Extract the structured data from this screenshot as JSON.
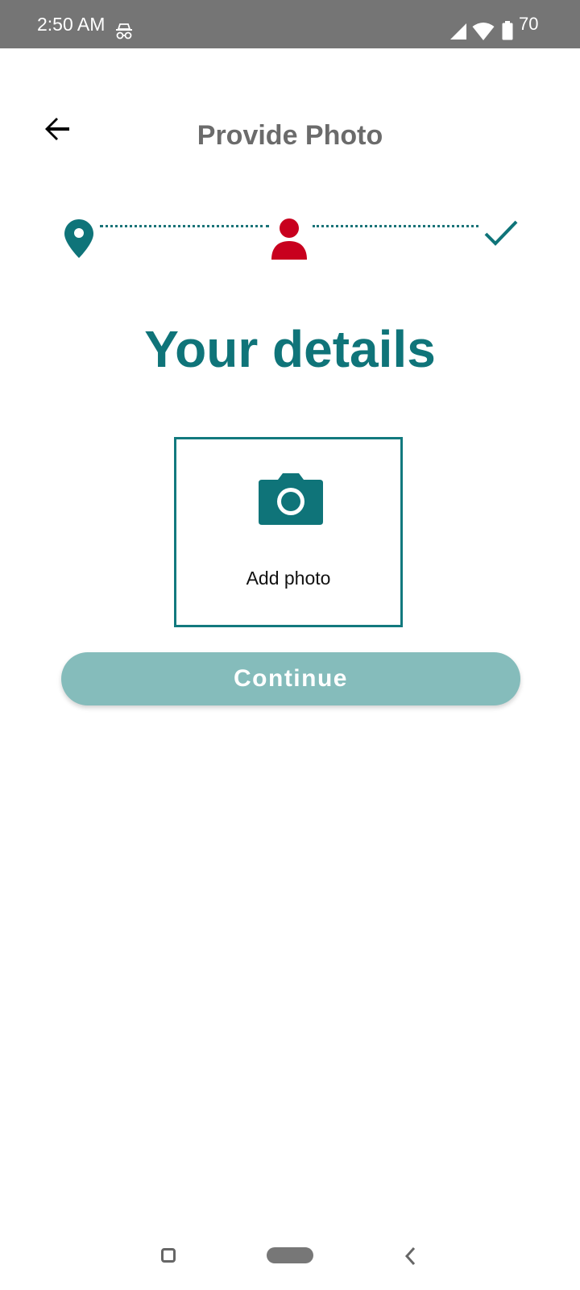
{
  "status_bar": {
    "time": "2:50 AM",
    "battery_level": "70",
    "icons": [
      "incognito-icon",
      "signal-icon",
      "wifi-icon",
      "battery-icon"
    ]
  },
  "header": {
    "title": "Provide Photo",
    "back_icon": "arrow-left-icon"
  },
  "stepper": {
    "steps": [
      {
        "icon": "location-pin-icon",
        "state": "completed"
      },
      {
        "icon": "person-icon",
        "state": "current"
      },
      {
        "icon": "check-icon",
        "state": "pending"
      }
    ]
  },
  "main": {
    "headline": "Your details",
    "photo_upload": {
      "icon": "camera-icon",
      "label": "Add photo"
    },
    "continue_label": "Continue"
  },
  "colors": {
    "accent": "#0f7479",
    "current_step": "#c8001e",
    "button_disabled": "#85bcbb",
    "title_gray": "#6b6b6b"
  },
  "nav_bar": {
    "icons": [
      "recents-icon",
      "home-icon",
      "back-icon"
    ]
  }
}
